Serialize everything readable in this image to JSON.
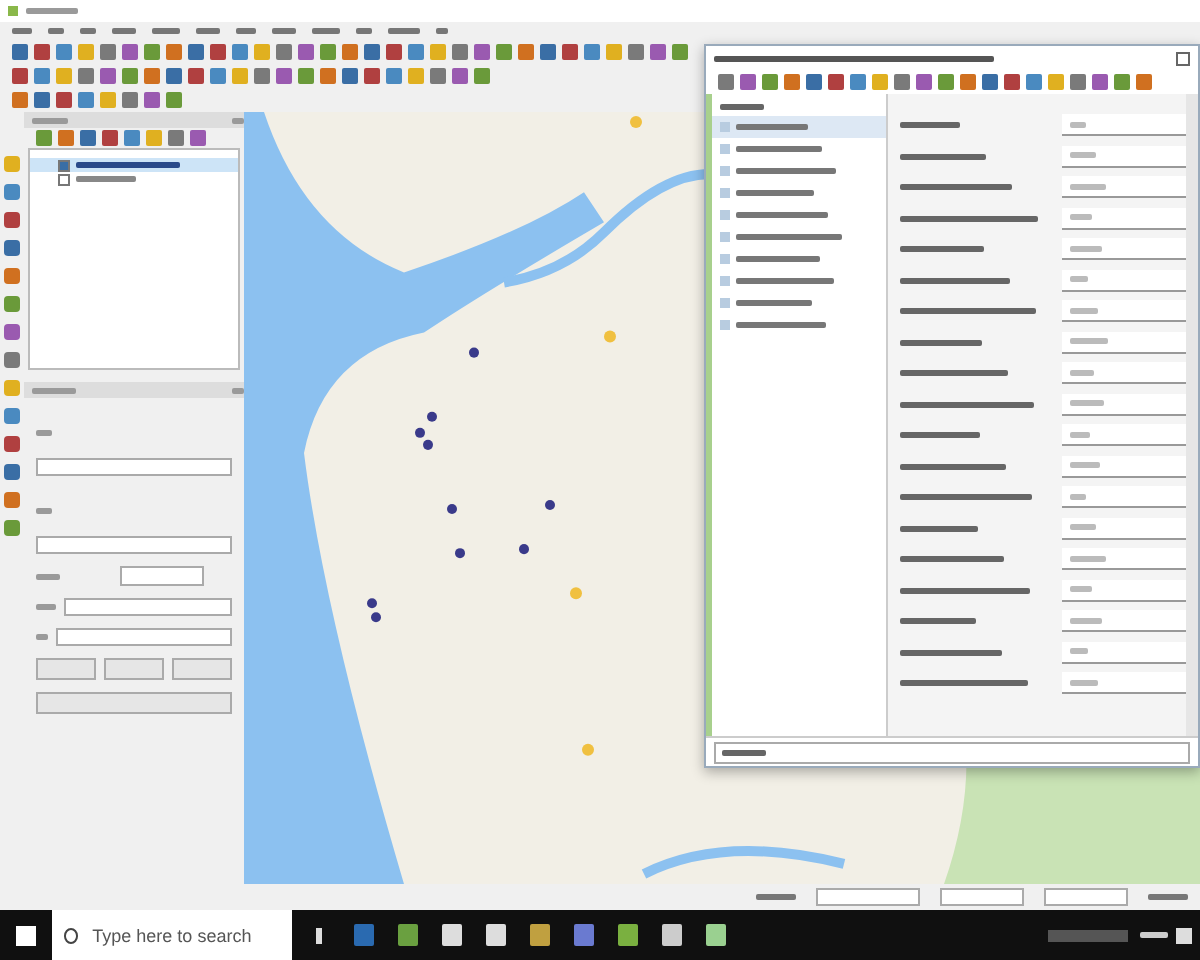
{
  "layers_panel": {
    "layers": [
      {
        "checked": true,
        "selected": true
      },
      {
        "checked": false,
        "selected": false
      }
    ]
  },
  "dialog": {
    "features": [
      {
        "selected": true
      },
      {
        "selected": false
      },
      {
        "selected": false
      },
      {
        "selected": false
      },
      {
        "selected": false
      },
      {
        "selected": false
      },
      {
        "selected": false
      },
      {
        "selected": false
      },
      {
        "selected": false
      },
      {
        "selected": false
      }
    ]
  },
  "taskbar": {
    "search": {
      "placeholder": "Type here to search"
    }
  }
}
